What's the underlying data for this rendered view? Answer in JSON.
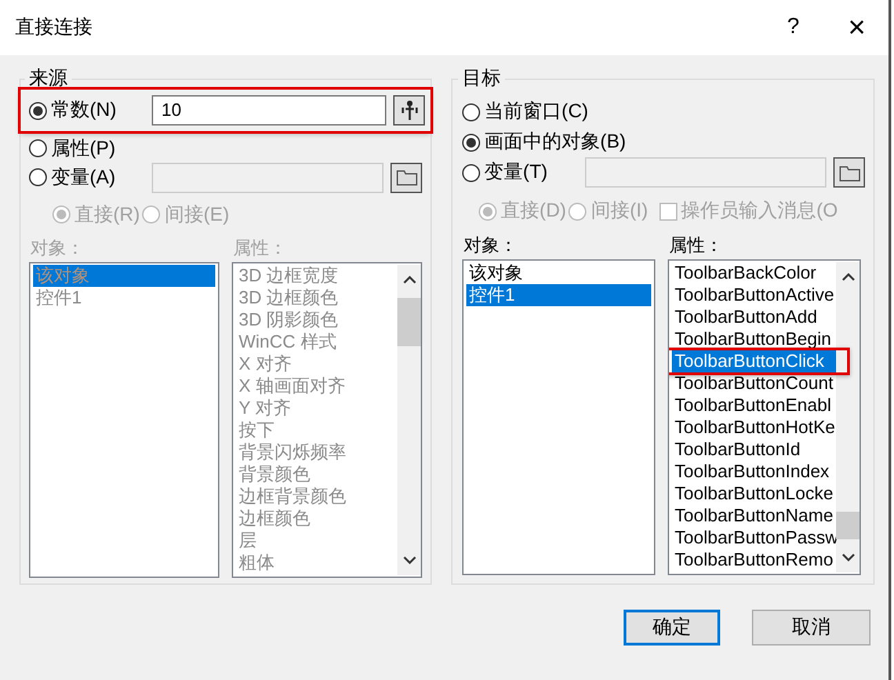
{
  "window": {
    "title": "直接连接",
    "help": "?",
    "close": "×"
  },
  "source": {
    "title": "来源",
    "options": [
      {
        "label": "常数(N)",
        "selected": true,
        "highlighted": true,
        "kind": "value",
        "value": "10"
      },
      {
        "label": "属性(P)",
        "selected": false,
        "highlighted": false,
        "kind": "plain"
      },
      {
        "label": "变量(A)",
        "selected": false,
        "highlighted": false,
        "kind": "tag"
      }
    ],
    "mode": [
      {
        "label": "直接(R)",
        "selected": true,
        "disabled": true
      },
      {
        "label": "间接(E)",
        "selected": false,
        "disabled": true
      }
    ],
    "objects_label": "对象：",
    "properties_label": "属性：",
    "disabled": true,
    "objects": [
      {
        "text": "该对象",
        "selected": true
      },
      {
        "text": "控件1",
        "selected": false
      }
    ],
    "properties": [
      {
        "text": "3D 边框宽度",
        "selected": false,
        "highlighted": false
      },
      {
        "text": "3D 边框颜色",
        "selected": false,
        "highlighted": false
      },
      {
        "text": "3D 阴影颜色",
        "selected": false,
        "highlighted": false
      },
      {
        "text": "WinCC 样式",
        "selected": false,
        "highlighted": false
      },
      {
        "text": "X 对齐",
        "selected": false,
        "highlighted": false
      },
      {
        "text": "X 轴画面对齐",
        "selected": false,
        "highlighted": false
      },
      {
        "text": "Y 对齐",
        "selected": false,
        "highlighted": false
      },
      {
        "text": "按下",
        "selected": false,
        "highlighted": false
      },
      {
        "text": "背景闪烁频率",
        "selected": false,
        "highlighted": false
      },
      {
        "text": "背景颜色",
        "selected": false,
        "highlighted": false
      },
      {
        "text": "边框背景颜色",
        "selected": false,
        "highlighted": false
      },
      {
        "text": "边框颜色",
        "selected": false,
        "highlighted": false
      },
      {
        "text": "层",
        "selected": false,
        "highlighted": false
      },
      {
        "text": "粗体",
        "selected": false,
        "highlighted": false
      }
    ]
  },
  "target": {
    "title": "目标",
    "options": [
      {
        "label": "当前窗口(C)",
        "selected": false,
        "highlighted": false,
        "kind": "plain"
      },
      {
        "label": "画面中的对象(B)",
        "selected": true,
        "highlighted": false,
        "kind": "plain"
      },
      {
        "label": "变量(T)",
        "selected": false,
        "highlighted": false,
        "kind": "tag"
      }
    ],
    "mode": [
      {
        "label": "直接(D)",
        "selected": true,
        "disabled": true
      },
      {
        "label": "间接(I)",
        "selected": false,
        "disabled": true
      }
    ],
    "operator_message": {
      "label": "操作员输入消息(O",
      "checked": false,
      "disabled": true
    },
    "objects_label": "对象：",
    "properties_label": "属性：",
    "disabled": false,
    "objects": [
      {
        "text": "该对象",
        "selected": false
      },
      {
        "text": "控件1",
        "selected": true
      }
    ],
    "properties": [
      {
        "text": "ToolbarBackColor",
        "selected": false,
        "highlighted": false
      },
      {
        "text": "ToolbarButtonActive",
        "selected": false,
        "highlighted": false
      },
      {
        "text": "ToolbarButtonAdd",
        "selected": false,
        "highlighted": false
      },
      {
        "text": "ToolbarButtonBegin",
        "selected": false,
        "highlighted": false
      },
      {
        "text": "ToolbarButtonClick",
        "selected": true,
        "highlighted": true
      },
      {
        "text": "ToolbarButtonCount",
        "selected": false,
        "highlighted": false
      },
      {
        "text": "ToolbarButtonEnabl",
        "selected": false,
        "highlighted": false
      },
      {
        "text": "ToolbarButtonHotKe",
        "selected": false,
        "highlighted": false
      },
      {
        "text": "ToolbarButtonId",
        "selected": false,
        "highlighted": false
      },
      {
        "text": "ToolbarButtonIndex",
        "selected": false,
        "highlighted": false
      },
      {
        "text": "ToolbarButtonLocke",
        "selected": false,
        "highlighted": false
      },
      {
        "text": "ToolbarButtonName",
        "selected": false,
        "highlighted": false
      },
      {
        "text": "ToolbarButtonPassw",
        "selected": false,
        "highlighted": false
      },
      {
        "text": "ToolbarButtonRemo",
        "selected": false,
        "highlighted": false
      }
    ]
  },
  "buttons": [
    {
      "label": "确定",
      "selected": true
    },
    {
      "label": "取消",
      "selected": false
    }
  ]
}
